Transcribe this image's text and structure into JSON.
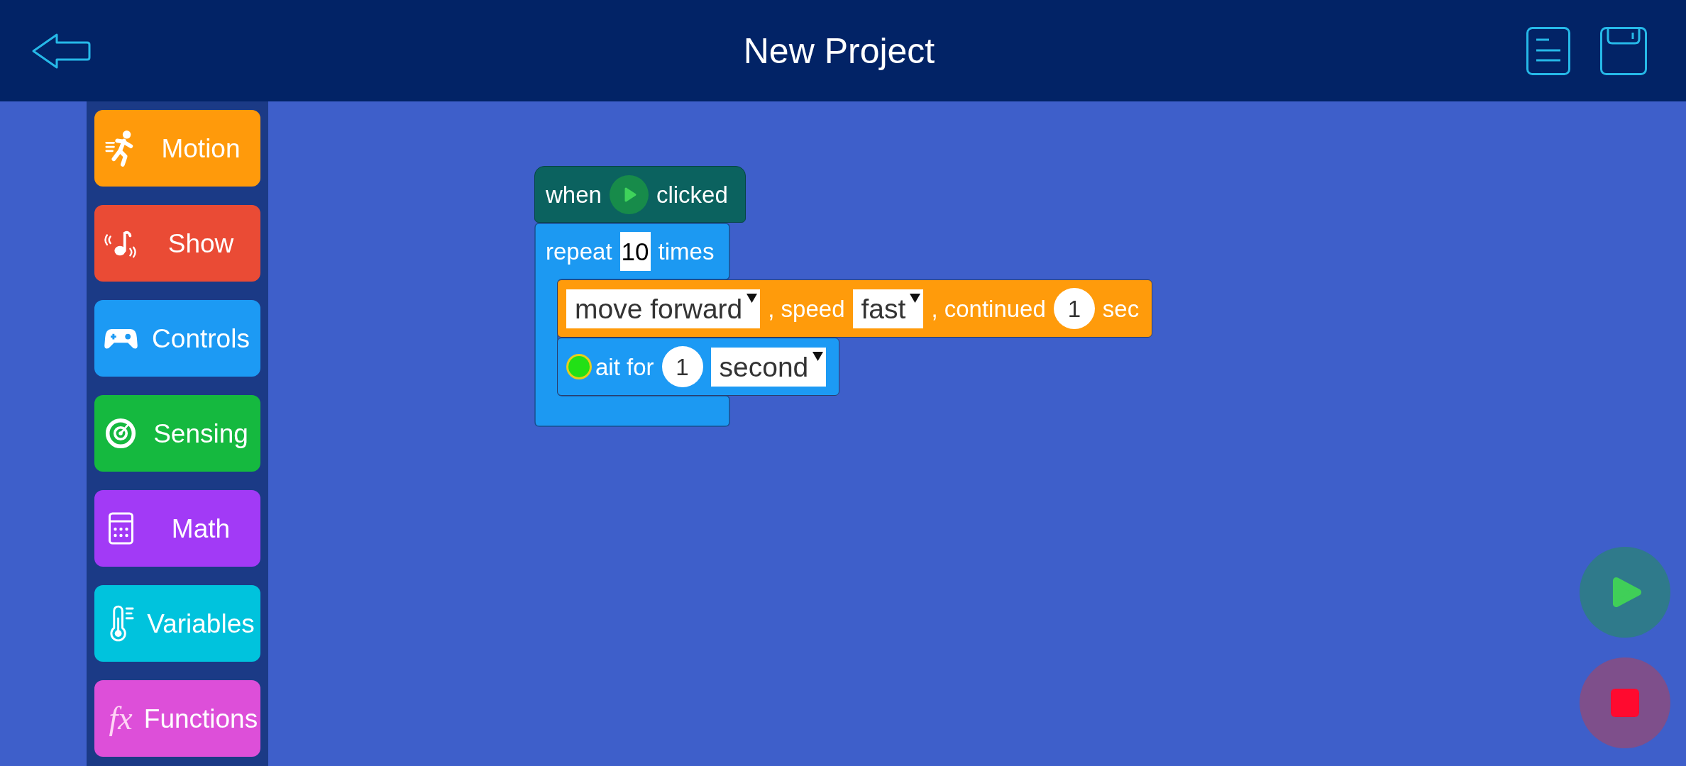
{
  "top_bar": {
    "title": "New Project"
  },
  "categories": [
    {
      "label": "Motion",
      "color": "#ff9a0b"
    },
    {
      "label": "Show",
      "color": "#ea4b35"
    },
    {
      "label": "Controls",
      "color": "#1c9af4"
    },
    {
      "label": "Sensing",
      "color": "#15b93f"
    },
    {
      "label": "Math",
      "color": "#a23af6"
    },
    {
      "label": "Variables",
      "color": "#00c3dd"
    },
    {
      "label": "Functions",
      "color": "#dd4fd9",
      "glyph": "fx"
    }
  ],
  "script": {
    "event_block": {
      "label_before": "when",
      "label_after": "clicked"
    },
    "repeat_block": {
      "label_before": "repeat",
      "count": "10",
      "label_after": "times"
    },
    "blocks": [
      {
        "color": "#ff9b0b",
        "parts": [
          {
            "kind": "dropdown",
            "text": "move forward"
          },
          {
            "kind": "label",
            "text": ", speed"
          },
          {
            "kind": "dropdown",
            "text": "fast"
          },
          {
            "kind": "label",
            "text": ", continued"
          },
          {
            "kind": "number",
            "text": "1"
          },
          {
            "kind": "label",
            "text": "sec"
          }
        ]
      },
      {
        "color": "#1c9af4",
        "parts": [
          {
            "kind": "touch_point"
          },
          {
            "kind": "label",
            "text": "ait for"
          },
          {
            "kind": "number",
            "text": "1"
          },
          {
            "kind": "dropdown",
            "text": "second"
          }
        ]
      }
    ]
  }
}
